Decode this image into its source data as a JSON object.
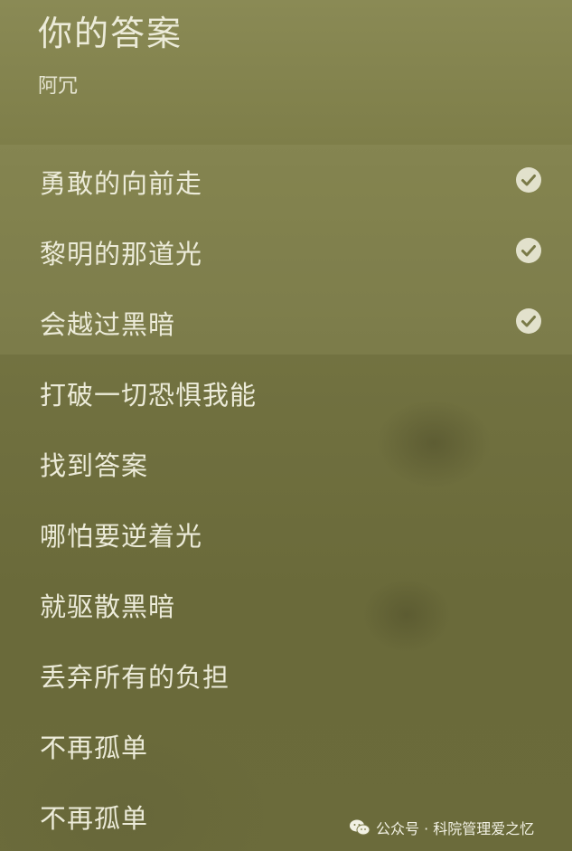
{
  "header": {
    "song_title": "你的答案",
    "artist": "阿冗"
  },
  "lyrics": [
    {
      "text": "勇敢的向前走",
      "selected": true
    },
    {
      "text": "黎明的那道光",
      "selected": true
    },
    {
      "text": "会越过黑暗",
      "selected": true
    },
    {
      "text": "打破一切恐惧我能",
      "selected": false
    },
    {
      "text": "找到答案",
      "selected": false
    },
    {
      "text": "哪怕要逆着光",
      "selected": false
    },
    {
      "text": "就驱散黑暗",
      "selected": false
    },
    {
      "text": "丢弃所有的负担",
      "selected": false
    },
    {
      "text": "不再孤单",
      "selected": false
    },
    {
      "text": "不再孤单",
      "selected": false
    }
  ],
  "watermark": {
    "text": "公众号 · 科院管理爱之忆",
    "icon": "wechat-icon"
  },
  "colors": {
    "background": "#717140",
    "text": "#ecebd9",
    "check_fill": "#e2e1cc",
    "check_mark": "#7a7a48"
  }
}
